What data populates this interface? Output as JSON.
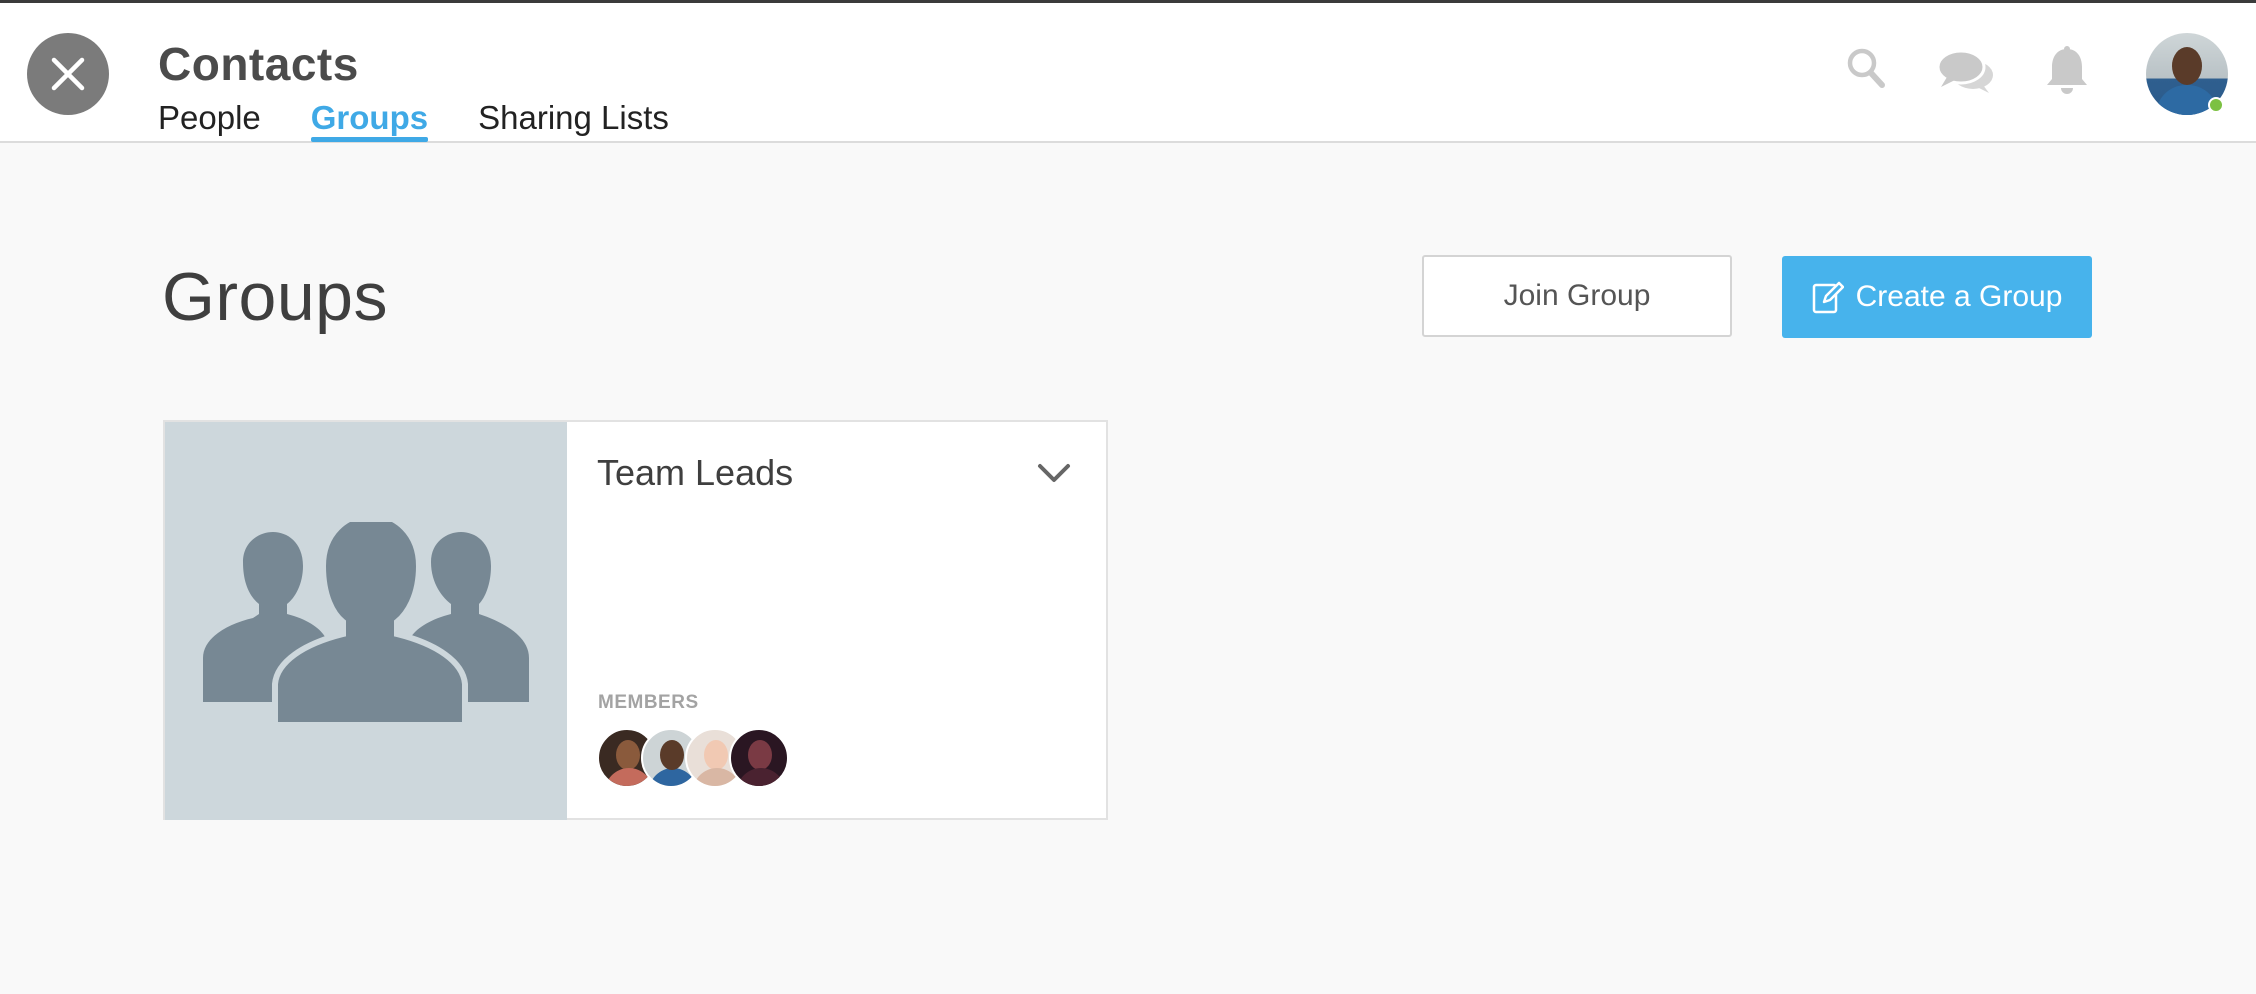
{
  "header": {
    "app_title": "Contacts",
    "tabs": [
      {
        "label": "People",
        "active": false
      },
      {
        "label": "Groups",
        "active": true
      },
      {
        "label": "Sharing Lists",
        "active": false
      }
    ],
    "icons": [
      "search-icon",
      "chat-icon",
      "bell-icon"
    ],
    "presence_status": "online",
    "accent_color": "#3fa9e6"
  },
  "main": {
    "page_title": "Groups",
    "join_button": "Join Group",
    "create_button": "Create a Group",
    "create_button_color": "#47b3ec"
  },
  "groups": [
    {
      "name": "Team Leads",
      "members_label": "MEMBERS",
      "member_count_shown": 4
    }
  ]
}
